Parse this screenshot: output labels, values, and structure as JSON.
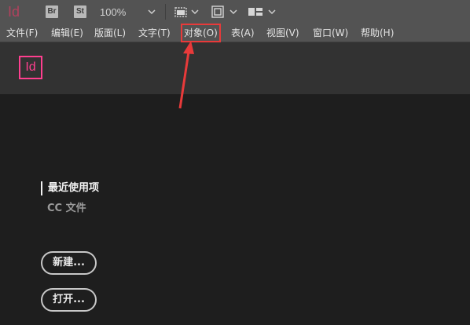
{
  "app": {
    "logo_text": "Id",
    "bridge_badge": "Br",
    "stock_badge": "St",
    "zoom": "100%"
  },
  "menu": {
    "items": [
      "文件(F)",
      "编辑(E)",
      "版面(L)",
      "文字(T)",
      "对象(O)",
      "表(A)",
      "视图(V)",
      "窗口(W)",
      "帮助(H)"
    ],
    "highlighted_item": "对象(O)"
  },
  "welcome": {
    "logo_text": "Id",
    "recent_label": "最近使用项",
    "cc_files_label": "CC 文件",
    "new_button": "新建...",
    "open_button": "打开..."
  },
  "colors": {
    "annotation": "#e83a3a",
    "indesign_brand": "#ff3f8f"
  },
  "icons": [
    "chevron-down-icon",
    "frame-icon",
    "screen-mode-icon",
    "workspace-layout-icon"
  ]
}
